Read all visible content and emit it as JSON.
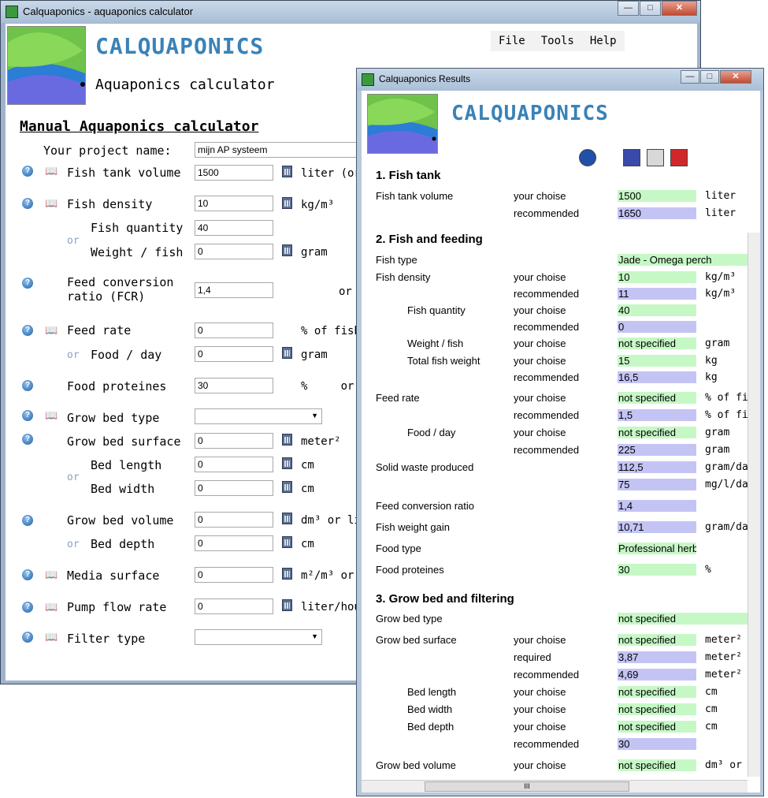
{
  "main": {
    "title": "Calquaponics - aquaponics calculator",
    "brand": "CALQUAPONICS",
    "subtitle": "Aquaponics calculator",
    "menu": [
      "File",
      "Tools",
      "Help"
    ],
    "heading": "Manual Aquaponics calculator",
    "project_label": "Your project name:",
    "project_value": "mijn AP systeem",
    "or": "or",
    "fields": {
      "fish_tank_volume": {
        "label": "Fish tank volume",
        "value": "1500",
        "unit": "liter (or"
      },
      "fish_density": {
        "label": "Fish density",
        "value": "10",
        "unit": "kg/m³"
      },
      "fish_quantity": {
        "label": "Fish quantity",
        "value": "40"
      },
      "weight_fish": {
        "label": "Weight / fish",
        "value": "0",
        "unit": "gram"
      },
      "fcr_1": {
        "label": "Feed conversion",
        "label2": "ratio (FCR)",
        "value": "1,4",
        "unit": "or"
      },
      "feed_rate": {
        "label": "Feed rate",
        "value": "0",
        "unit": "% of fish"
      },
      "food_day": {
        "label": "Food / day",
        "value": "0",
        "unit": "gram"
      },
      "food_proteines": {
        "label": "Food proteines",
        "value": "30",
        "unit": "%     or"
      },
      "grow_bed_type": {
        "label": "Grow bed type"
      },
      "grow_bed_surface": {
        "label": "Grow bed surface",
        "value": "0",
        "unit": "meter²"
      },
      "bed_length": {
        "label": "Bed length",
        "value": "0",
        "unit": "cm"
      },
      "bed_width": {
        "label": "Bed width",
        "value": "0",
        "unit": "cm"
      },
      "grow_bed_volume": {
        "label": "Grow bed volume",
        "value": "0",
        "unit": "dm³ or li"
      },
      "bed_depth": {
        "label": "Bed depth",
        "value": "0",
        "unit": "cm"
      },
      "media_surface": {
        "label": "Media surface",
        "value": "0",
        "unit": "m²/m³ or"
      },
      "pump_flow_rate": {
        "label": "Pump flow rate",
        "value": "0",
        "unit": "liter/hou"
      },
      "filter_type": {
        "label": "Filter type"
      }
    }
  },
  "results": {
    "title": "Calquaponics Results",
    "brand": "CALQUAPONICS",
    "sections": [
      "1. Fish tank",
      "2. Fish and feeding",
      "3. Grow bed and filtering"
    ],
    "your": "your choise",
    "rec": "recommended",
    "req": "required",
    "rows": {
      "ftv": {
        "label": "Fish tank volume",
        "v1": "1500",
        "v2": "1650",
        "unit": "liter"
      },
      "ftype": {
        "label": "Fish type",
        "v": "Jade - Omega perch"
      },
      "fdens": {
        "label": "Fish density",
        "v1": "10",
        "v2": "11",
        "unit": "kg/m³"
      },
      "fqty": {
        "label": "Fish quantity",
        "v1": "40",
        "v2": "0"
      },
      "wfish": {
        "label": "Weight / fish",
        "v1": "not specified",
        "unit": "gram"
      },
      "tfw": {
        "label": "Total fish weight",
        "v1": "15",
        "v2": "16,5",
        "unit": "kg"
      },
      "frate": {
        "label": "Feed rate",
        "v1": "not specified",
        "v2": "1,5",
        "unit": "% of fi"
      },
      "fday": {
        "label": "Food / day",
        "v1": "not specified",
        "v2": "225",
        "unit": "gram"
      },
      "swp": {
        "label": "Solid waste produced",
        "v1": "112,5",
        "v2": "75",
        "u1": "gram/da",
        "u2": "mg/l/da"
      },
      "fcr": {
        "label": "Feed conversion ratio",
        "v": "1,4"
      },
      "fwg": {
        "label": "Fish weight gain",
        "v": "10,71",
        "unit": "gram/da"
      },
      "ftyp": {
        "label": "Food type",
        "v": "Professional herb"
      },
      "fprot": {
        "label": "Food proteines",
        "v": "30",
        "unit": "%"
      },
      "gbt": {
        "label": "Grow bed type",
        "v": "not specified"
      },
      "gbs": {
        "label": "Grow bed surface",
        "v1": "not specified",
        "v2": "3,87",
        "v3": "4,69",
        "unit": "meter²"
      },
      "blen": {
        "label": "Bed length",
        "v": "not specified",
        "unit": "cm"
      },
      "bwid": {
        "label": "Bed width",
        "v": "not specified",
        "unit": "cm"
      },
      "bdep": {
        "label": "Bed depth",
        "v1": "not specified",
        "v2": "30",
        "unit": "cm"
      },
      "gbv": {
        "label": "Grow bed volume",
        "v": "not specified",
        "unit": "dm³ or"
      }
    },
    "scroll_mark": "III"
  },
  "colors": {
    "brand": "#3a82b8",
    "choice": "#c6f8c6",
    "recommended": "#c4c4f4"
  }
}
